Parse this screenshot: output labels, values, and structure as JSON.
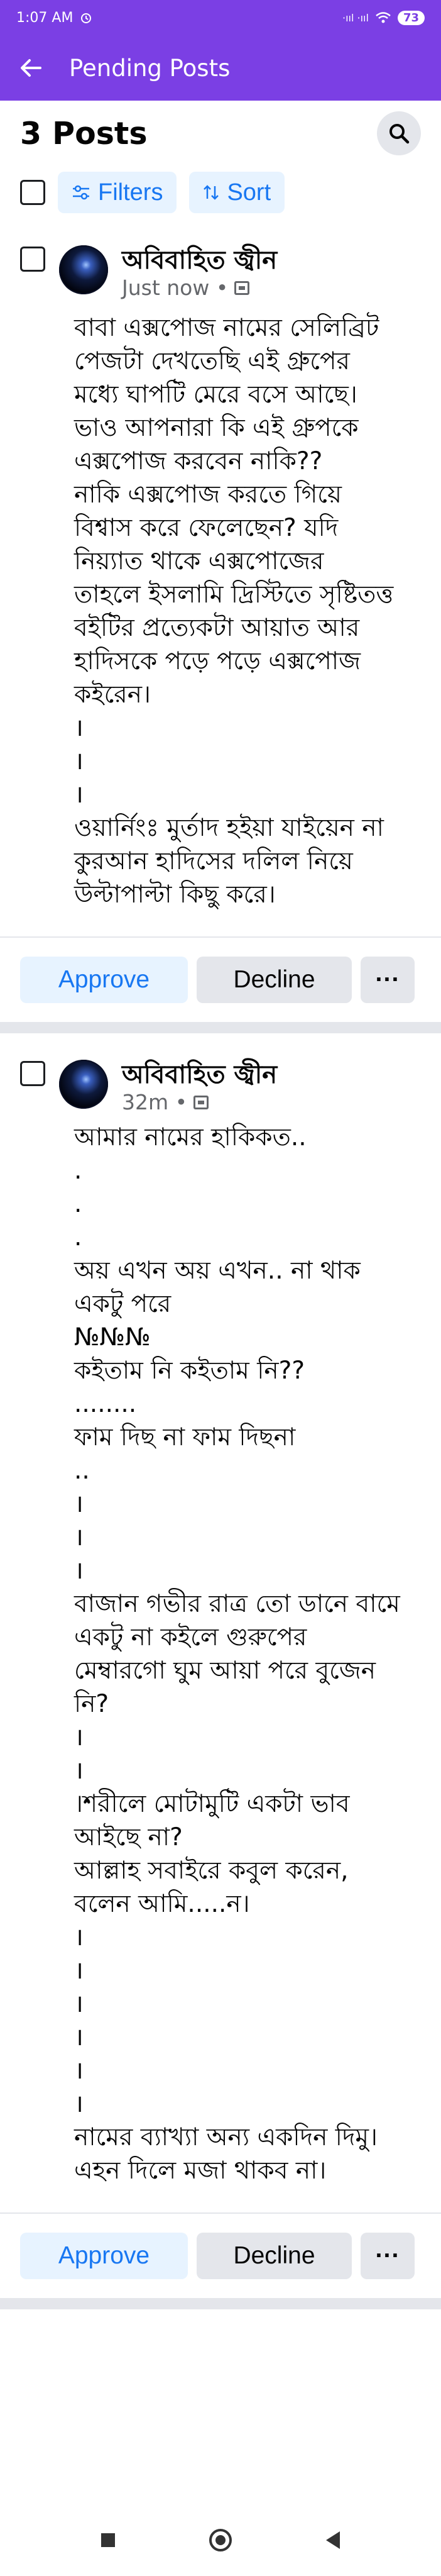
{
  "status_bar": {
    "time": "1:07 AM",
    "signal": "·ııl ·ııl",
    "battery": "73"
  },
  "app_bar": {
    "title": "Pending Posts"
  },
  "posts_header": {
    "count_label": "3 Posts"
  },
  "filters": {
    "filters_label": "Filters",
    "sort_label": "Sort"
  },
  "posts": [
    {
      "author": "অবিবাহিত জ্বীন",
      "meta": "Just now •",
      "lines": [
        "বাবা এক্সপোজ নামের সেলিব্রিট",
        "পেজটা দেখতেছি এই গ্রুপের",
        "মধ্যে ঘাপটি মেরে বসে আছে।",
        "ভাও আপনারা কি এই গ্রুপকে",
        "এক্সপোজ করবেন নাকি??",
        "নাকি এক্সপোজ করতে গিয়ে",
        "বিশ্বাস করে ফেলেছেন? যদি",
        "নিয়্যাত থাকে এক্সপোজের",
        "তাহলে ইসলামি দ্রিস্টিতে সৃষ্টিতত্ত",
        "বইটির প্রত্যেকটা আয়াত আর",
        "হাদিসকে পড়ে পড়ে এক্সপোজ",
        "কইরেন।",
        "।",
        "।",
        "।",
        "ওয়ার্নিংঃ মুর্তাদ হইয়া যাইয়েন না",
        "কুরআন হাদিসের দলিল নিয়ে",
        "উল্টাপাল্টা কিছু করে।"
      ],
      "approve_label": "Approve",
      "decline_label": "Decline",
      "more_label": "···"
    },
    {
      "author": "অবিবাহিত জ্বীন",
      "meta": "32m •",
      "lines": [
        "আমার নামের হাকিকত..",
        ".",
        ".",
        ".",
        "অয় এখন অয় এখন.. না থাক",
        "একটু পরে",
        "№№№",
        "কইতাম নি কইতাম নি??",
        "........",
        "ফাম দিছ না ফাম দিছনা",
        "..",
        "।",
        "।",
        "।",
        "বাজান গভীর রাত্র তো ডানে বামে",
        "একটু না কইলে গুরুপের",
        "মেম্বারগো ঘুম আয়া পরে বুজেন",
        "নি?",
        "।",
        "।",
        "।শরীলে মোটামুটি একটা ভাব",
        "আইছে না?",
        "আল্লাহ সবাইরে কবুল করেন,",
        "বলেন আমি.....ন।",
        "।",
        "।",
        "।",
        "।",
        "।",
        "।",
        "নামের ব্যাখ্যা অন্য একদিন দিমু।",
        "এহন দিলে মজা থাকব না।"
      ],
      "approve_label": "Approve",
      "decline_label": "Decline",
      "more_label": "···"
    }
  ],
  "colors": {
    "brand": "#7b3fe4",
    "link": "#1877f2",
    "chip_bg": "#e7f3ff",
    "gray_bg": "#e4e6eb"
  },
  "icons": [
    "back-arrow-icon",
    "search-icon",
    "filters-icon",
    "sort-icon",
    "privacy-icon",
    "more-icon"
  ]
}
